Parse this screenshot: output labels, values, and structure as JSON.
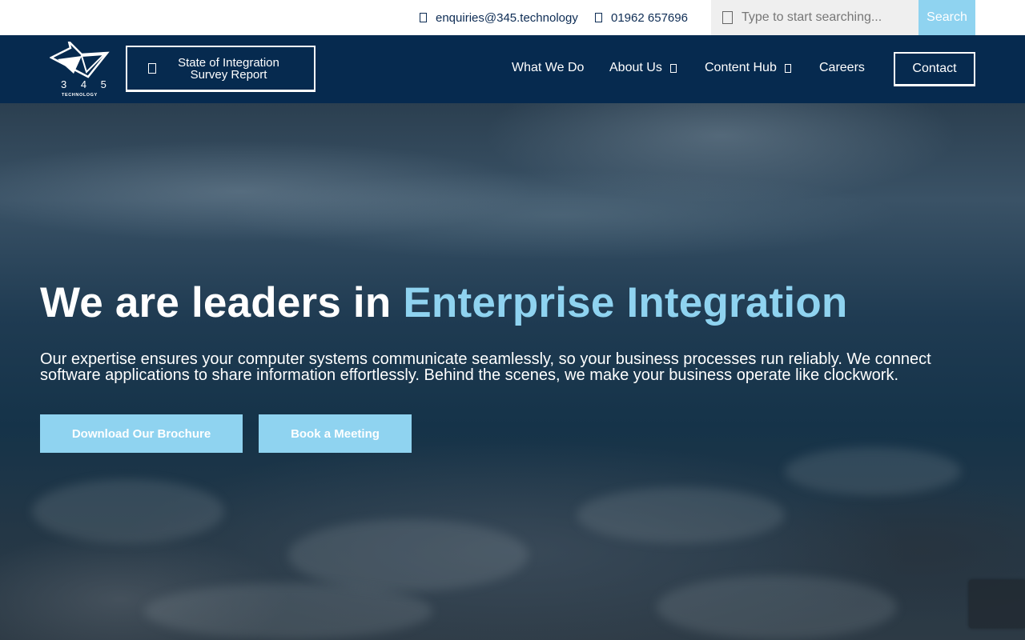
{
  "topbar": {
    "email": "enquiries@345.technology",
    "phone": "01962 657696",
    "search_placeholder": "Type to start searching...",
    "search_button": "Search"
  },
  "navbar": {
    "logo_text": "3 4 5",
    "logo_subtext": "TECHNOLOGY",
    "survey_line1": "State of Integration",
    "survey_line2": "Survey Report",
    "items": [
      {
        "label": "What We Do"
      },
      {
        "label": "About Us"
      },
      {
        "label": "Content Hub"
      },
      {
        "label": "Careers"
      }
    ],
    "contact": "Contact"
  },
  "hero": {
    "title_part1": "We are leaders in ",
    "title_accent": "Enterprise Integration",
    "description": "Our expertise ensures your computer systems communicate seamlessly, so your business processes run reliably. We connect software applications to share information effortlessly. Behind the scenes, we make your business operate like clockwork.",
    "buttons": [
      {
        "label": "Download Our Brochure"
      },
      {
        "label": "Book a Meeting"
      }
    ]
  },
  "colors": {
    "navy": "#062a4f",
    "accent": "#8fd3f0",
    "white": "#ffffff"
  },
  "icons": [
    "envelope-icon",
    "phone-icon",
    "search-icon",
    "document-icon",
    "chevron-down-icon"
  ]
}
